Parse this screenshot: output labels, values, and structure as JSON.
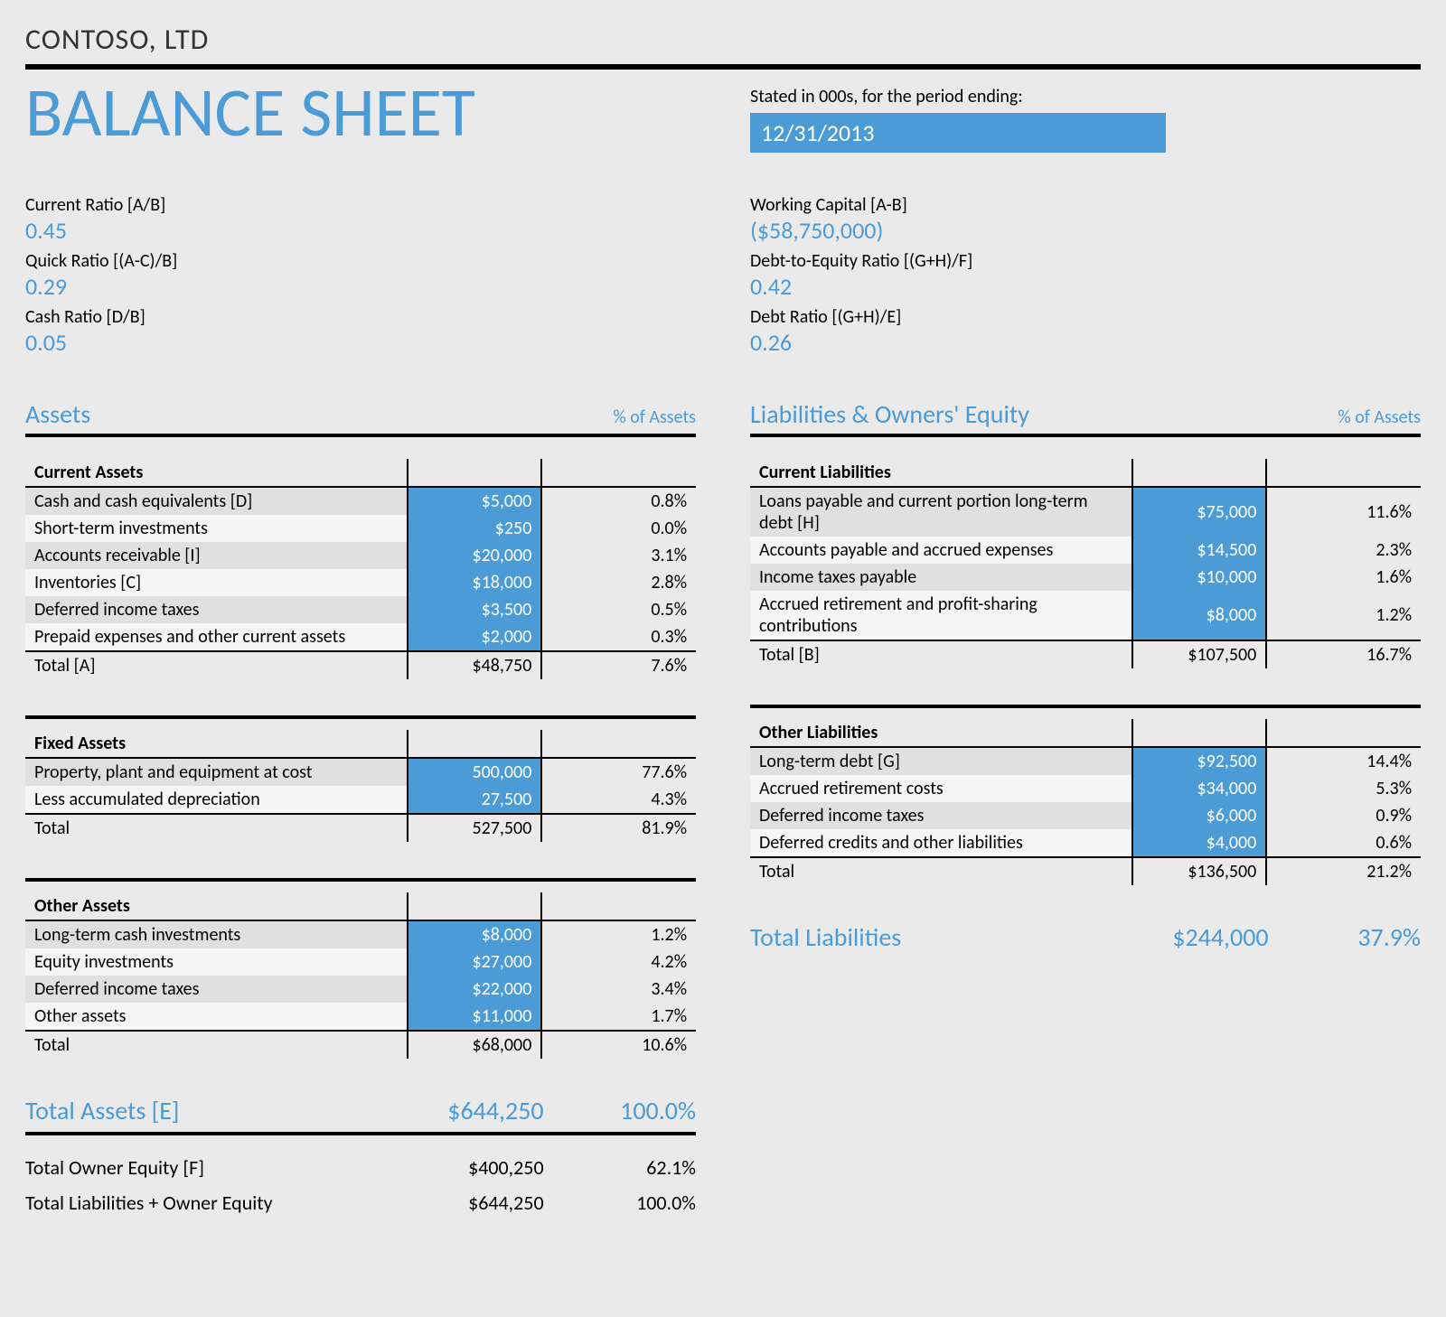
{
  "company": "CONTOSO, LTD",
  "title": "BALANCE SHEET",
  "stated_label": "Stated in 000s, for the period ending:",
  "period_end": "12/31/2013",
  "ratios_left": [
    {
      "label": "Current Ratio   [A/B]",
      "value": "0.45"
    },
    {
      "label": "Quick Ratio   [(A-C)/B]",
      "value": "0.29"
    },
    {
      "label": "Cash Ratio   [D/B]",
      "value": "0.05"
    }
  ],
  "ratios_right": [
    {
      "label": "Working Capital   [A-B]",
      "value": "($58,750,000)"
    },
    {
      "label": "Debt-to-Equity Ratio   [(G+H)/F]",
      "value": "0.42"
    },
    {
      "label": "Debt Ratio   [(G+H)/E]",
      "value": "0.26"
    }
  ],
  "assets_header": "Assets",
  "liab_header": "Liabilities & Owners' Equity",
  "pct_label": "% of Assets",
  "groups_left": [
    {
      "title": "Current Assets",
      "rows": [
        {
          "label": "Cash and cash equivalents   [D]",
          "val": "$5,000",
          "pct": "0.8%"
        },
        {
          "label": "Short-term investments",
          "val": "$250",
          "pct": "0.0%"
        },
        {
          "label": "Accounts receivable   [I]",
          "val": "$20,000",
          "pct": "3.1%"
        },
        {
          "label": "Inventories   [C]",
          "val": "$18,000",
          "pct": "2.8%"
        },
        {
          "label": "Deferred income taxes",
          "val": "$3,500",
          "pct": "0.5%"
        },
        {
          "label": "Prepaid expenses and other current assets",
          "val": "$2,000",
          "pct": "0.3%"
        }
      ],
      "total": {
        "label": "Total   [A]",
        "val": "$48,750",
        "pct": "7.6%"
      }
    },
    {
      "title": "Fixed Assets",
      "rows": [
        {
          "label": "Property, plant and equipment at cost",
          "val": "500,000",
          "pct": "77.6%"
        },
        {
          "label": "Less accumulated depreciation",
          "val": "27,500",
          "pct": "4.3%"
        }
      ],
      "total": {
        "label": "Total",
        "val": "527,500",
        "pct": "81.9%"
      }
    },
    {
      "title": "Other Assets",
      "rows": [
        {
          "label": "Long-term cash investments",
          "val": "$8,000",
          "pct": "1.2%"
        },
        {
          "label": "Equity investments",
          "val": "$27,000",
          "pct": "4.2%"
        },
        {
          "label": "Deferred income taxes",
          "val": "$22,000",
          "pct": "3.4%"
        },
        {
          "label": "Other assets",
          "val": "$11,000",
          "pct": "1.7%"
        }
      ],
      "total": {
        "label": "Total",
        "val": "$68,000",
        "pct": "10.6%"
      }
    }
  ],
  "groups_right": [
    {
      "title": "Current Liabilities",
      "rows": [
        {
          "label": "Loans payable and current portion long-term debt   [H]",
          "val": "$75,000",
          "pct": "11.6%"
        },
        {
          "label": "Accounts payable and accrued expenses",
          "val": "$14,500",
          "pct": "2.3%"
        },
        {
          "label": "Income taxes payable",
          "val": "$10,000",
          "pct": "1.6%"
        },
        {
          "label": "Accrued retirement and profit-sharing contributions",
          "val": "$8,000",
          "pct": "1.2%"
        }
      ],
      "total": {
        "label": "Total   [B]",
        "val": "$107,500",
        "pct": "16.7%"
      }
    },
    {
      "title": "Other Liabilities",
      "rows": [
        {
          "label": "Long-term debt   [G]",
          "val": "$92,500",
          "pct": "14.4%"
        },
        {
          "label": "Accrued retirement costs",
          "val": "$34,000",
          "pct": "5.3%"
        },
        {
          "label": "Deferred income taxes",
          "val": "$6,000",
          "pct": "0.9%"
        },
        {
          "label": "Deferred credits and other liabilities",
          "val": "$4,000",
          "pct": "0.6%"
        }
      ],
      "total": {
        "label": "Total",
        "val": "$136,500",
        "pct": "21.2%"
      }
    }
  ],
  "total_assets": {
    "label": "Total Assets   [E]",
    "val": "$644,250",
    "pct": "100.0%"
  },
  "total_liabilities": {
    "label": "Total Liabilities",
    "val": "$244,000",
    "pct": "37.9%"
  },
  "owner_equity": {
    "label": "Total Owner Equity   [F]",
    "val": "$400,250",
    "pct": "62.1%"
  },
  "liab_owner": {
    "label": "Total Liabilities + Owner Equity",
    "val": "$644,250",
    "pct": "100.0%"
  }
}
